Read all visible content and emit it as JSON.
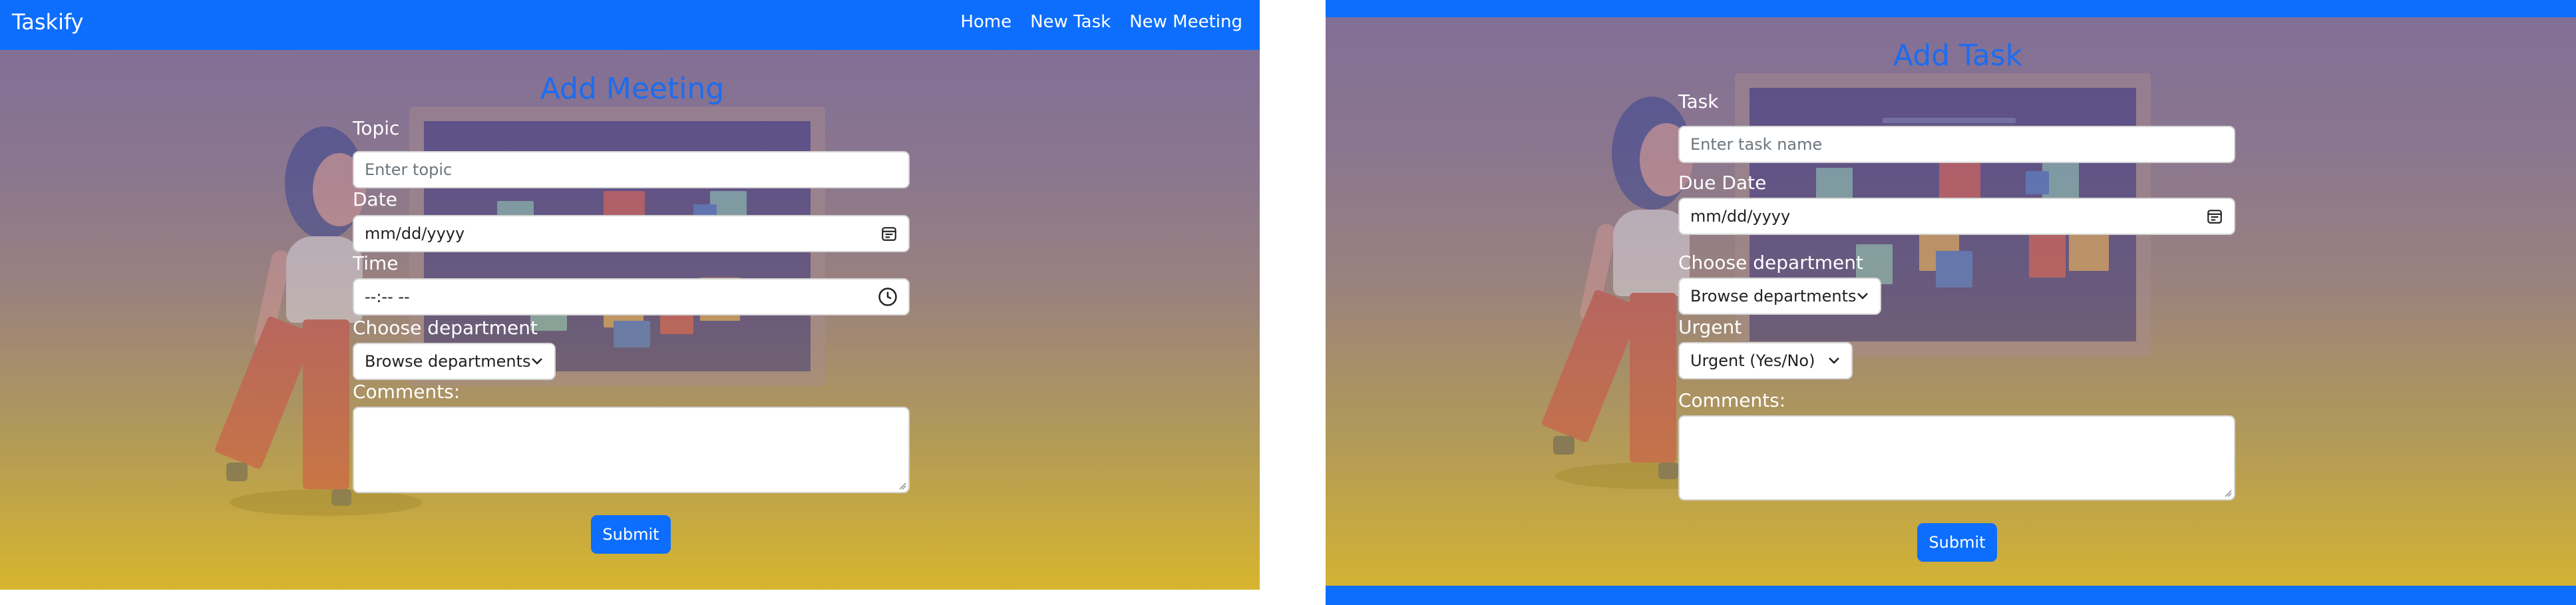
{
  "colors": {
    "primary": "#0d6efd",
    "title": "#1d6cf0"
  },
  "left": {
    "navbar": {
      "brand": "Taskify",
      "links": [
        "Home",
        "New Task",
        "New Meeting"
      ]
    },
    "form": {
      "title": "Add Meeting",
      "topic": {
        "label": "Topic",
        "placeholder": "Enter topic"
      },
      "date": {
        "label": "Date",
        "value": "mm/dd/yyyy",
        "icon": "calendar-icon"
      },
      "time": {
        "label": "Time",
        "value": "--:-- --",
        "icon": "clock-icon"
      },
      "department": {
        "label": "Choose department",
        "selected": "Browse departments"
      },
      "comments": {
        "label": "Comments:"
      },
      "submit": "Submit"
    }
  },
  "right": {
    "form": {
      "title": "Add Task",
      "task": {
        "label": "Task",
        "placeholder": "Enter task name"
      },
      "due_date": {
        "label": "Due Date",
        "value": "mm/dd/yyyy",
        "icon": "calendar-icon"
      },
      "department": {
        "label": "Choose department",
        "selected": "Browse departments"
      },
      "urgent": {
        "label": "Urgent",
        "selected": "Urgent (Yes/No)"
      },
      "comments": {
        "label": "Comments:"
      },
      "submit": "Submit"
    }
  }
}
